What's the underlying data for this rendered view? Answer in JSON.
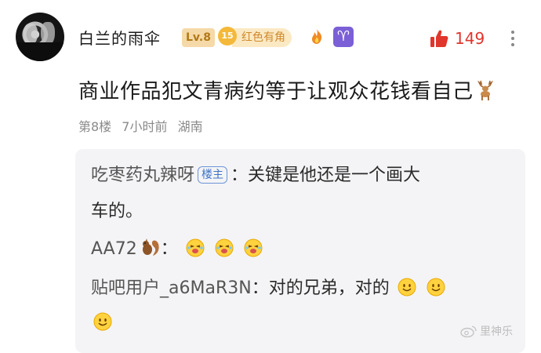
{
  "post": {
    "username": "白兰的雨伞",
    "level": "Lv.8",
    "badge_number": "15",
    "badge_text": "红色有角",
    "likes": "149",
    "content": "商业作品犯文青病约等于让观众花钱看自己",
    "floor": "第8楼",
    "time": "7小时前",
    "location": "湖南"
  },
  "replies": [
    {
      "name": "吃枣药丸辣呀",
      "tag": "楼主",
      "sep": "：",
      "text_line1": "关键是他还是一个画大",
      "text_line2": "车的。"
    },
    {
      "name": "AA72",
      "sep": "："
    },
    {
      "name": "贴吧用户_a6MaR3N",
      "sep": "：",
      "text": "对的兄弟，对的"
    }
  ],
  "watermark": "里神乐",
  "colors": {
    "like": "#e0362c",
    "reply_bg": "#f4f4f6",
    "level_bg": "#f6d9a8",
    "aries": "#7b5fd6"
  }
}
